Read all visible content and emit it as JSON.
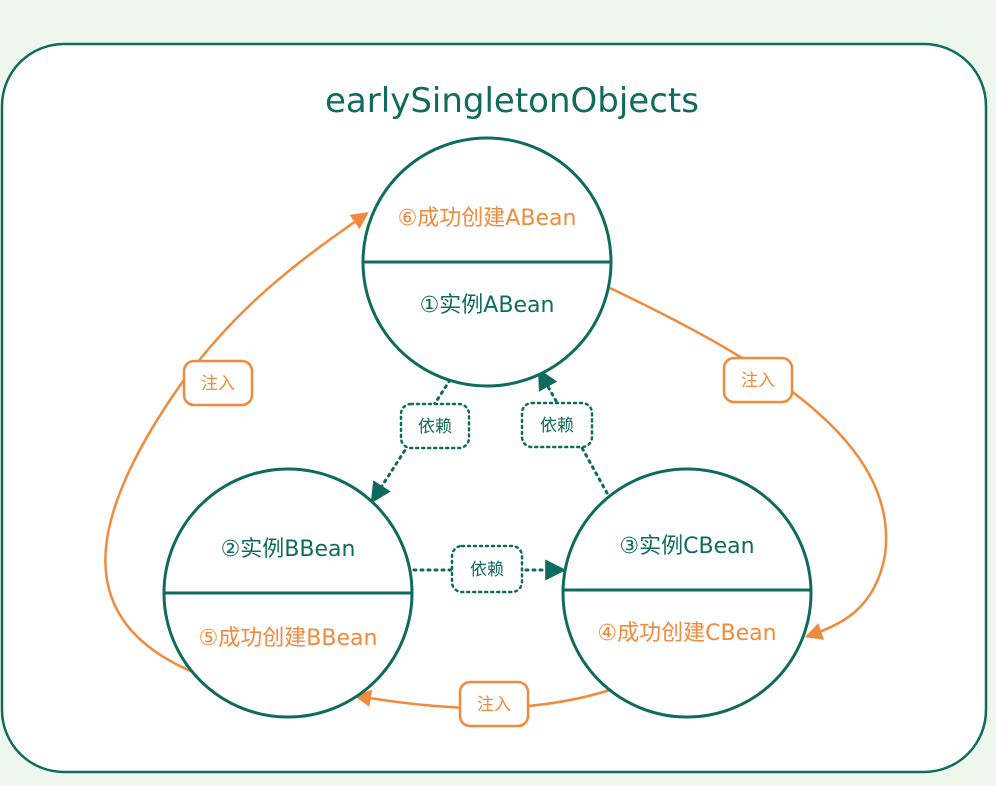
{
  "title": "earlySingletonObjects",
  "colors": {
    "teal": "#0f6b5e",
    "orange": "#f08a3c",
    "background": "#eef7ec",
    "panel": "#ffffff"
  },
  "nodes": {
    "a": {
      "top": "⑥成功创建ABean",
      "bottom": "①实例ABean"
    },
    "b": {
      "top": "②实例BBean",
      "bottom": "⑤成功创建BBean"
    },
    "c": {
      "top": "③实例CBean",
      "bottom": "④成功创建CBean"
    }
  },
  "labels": {
    "depend_a_b": "依赖",
    "depend_c_a": "依赖",
    "depend_b_c": "依赖",
    "inject_b_a": "注入",
    "inject_a_c": "注入",
    "inject_c_b": "注入"
  }
}
